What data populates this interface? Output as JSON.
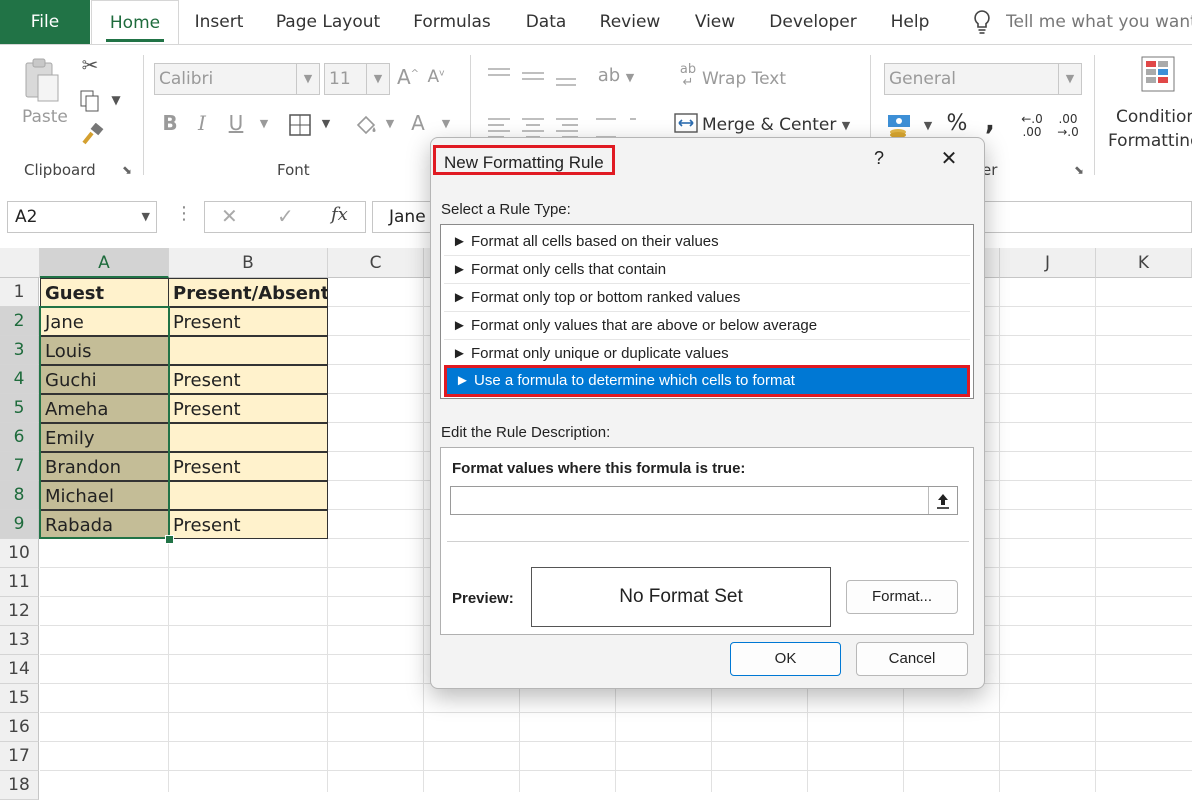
{
  "ribbon_tabs": [
    "File",
    "Home",
    "Insert",
    "Page Layout",
    "Formulas",
    "Data",
    "Review",
    "View",
    "Developer",
    "Help"
  ],
  "tell_me": "Tell me what you want",
  "ribbon": {
    "paste": "Paste",
    "clipboard": "Clipboard",
    "font_name": "Calibri",
    "font_size": "11",
    "font_group": "Font",
    "wrap_text": "Wrap Text",
    "merge_center": "Merge & Center",
    "number_format": "General",
    "number_group_partial": "er",
    "conditional_1": "Condition",
    "conditional_2": "Formatting",
    "bold": "B",
    "italic": "I",
    "underline": "U",
    "percent": "%",
    "comma": ",",
    "inc_dec_1": "←.0\n.00",
    "inc_dec_2": ".00\n→.0"
  },
  "formula_bar": {
    "name_box": "A2",
    "content": "Jane",
    "fx": "fx"
  },
  "columns": [
    "A",
    "B",
    "C",
    "J",
    "K"
  ],
  "rows": [
    "1",
    "2",
    "3",
    "4",
    "5",
    "6",
    "7",
    "8",
    "9",
    "10",
    "11",
    "12",
    "13",
    "14",
    "15",
    "16",
    "17",
    "18"
  ],
  "table": {
    "headers": [
      "Guest",
      "Present/Absent"
    ],
    "rows": [
      [
        "Jane",
        "Present"
      ],
      [
        "Louis",
        ""
      ],
      [
        "Guchi",
        "Present"
      ],
      [
        "Ameha",
        "Present"
      ],
      [
        "Emily",
        ""
      ],
      [
        "Brandon",
        "Present"
      ],
      [
        "Michael",
        ""
      ],
      [
        "Rabada",
        "Present"
      ]
    ]
  },
  "dialog": {
    "title": "New Formatting Rule",
    "help": "?",
    "close": "✕",
    "select_rule_type": "Select a Rule Type:",
    "rule_types": [
      "Format all cells based on their values",
      "Format only cells that contain",
      "Format only top or bottom ranked values",
      "Format only values that are above or below average",
      "Format only unique or duplicate values",
      "Use a formula to determine which cells to format"
    ],
    "selected_rule_index": 5,
    "edit_rule_description": "Edit the Rule Description:",
    "formula_label": "Format values where this formula is true:",
    "formula_value": "",
    "preview_label": "Preview:",
    "preview_text": "No Format Set",
    "format_button": "Format...",
    "ok_button": "OK",
    "cancel_button": "Cancel"
  },
  "colors": {
    "excel_green": "#217346",
    "highlight_red": "#e01a22",
    "selection_blue": "#0078d4",
    "table_fill": "#fff2cc",
    "selected_col_fill": "#c4bd97"
  }
}
